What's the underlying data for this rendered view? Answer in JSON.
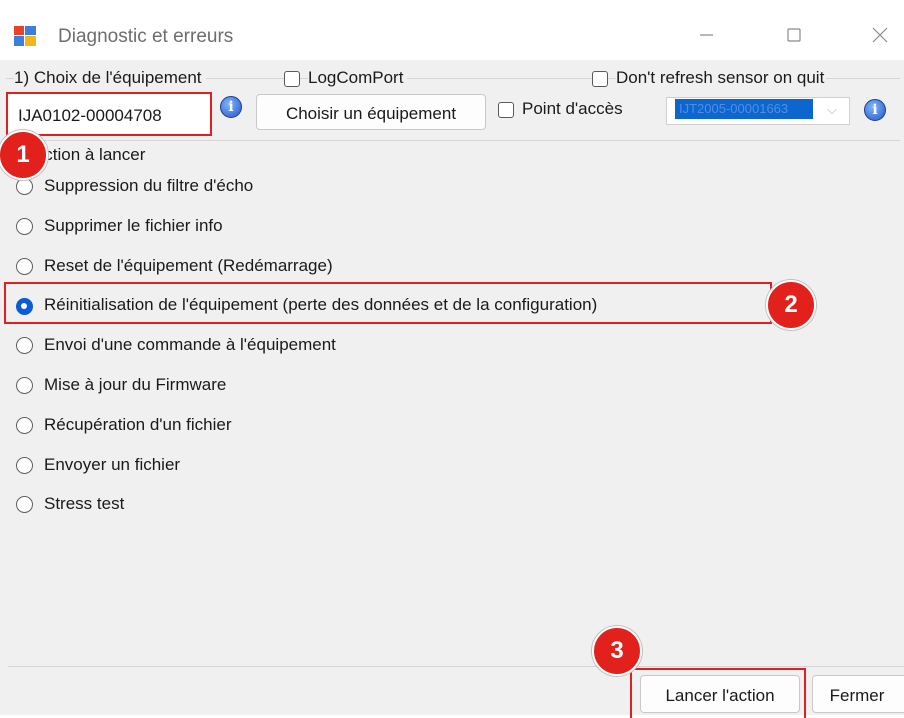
{
  "window": {
    "title": "Diagnostic et erreurs",
    "controls": {
      "minimize": "—",
      "maximize": "☐",
      "close": "✕"
    }
  },
  "equipment_section": {
    "label": "1) Choix de l'équipement",
    "logcomport_label": "LogComPort",
    "logcomport_checked": false,
    "dont_refresh_label": "Don't refresh sensor on quit",
    "dont_refresh_checked": false,
    "equipment_id": "IJA0102-00004708",
    "choose_button": "Choisir un équipement",
    "access_point_label": "Point d'accès",
    "access_point_checked": false,
    "access_point_value": "IJT2005-00001663"
  },
  "action_section": {
    "label": "2) Action à lancer",
    "options": [
      {
        "label": "Suppression du filtre d'écho",
        "selected": false
      },
      {
        "label": "Supprimer le fichier info",
        "selected": false
      },
      {
        "label": "Reset de l'équipement (Redémarrage)",
        "selected": false
      },
      {
        "label": "Réinitialisation de l'équipement (perte des données et de la configuration)",
        "selected": true
      },
      {
        "label": "Envoi d'une commande à l'équipement",
        "selected": false
      },
      {
        "label": "Mise à jour du Firmware",
        "selected": false
      },
      {
        "label": "Récupération d'un fichier",
        "selected": false
      },
      {
        "label": "Envoyer un fichier",
        "selected": false
      },
      {
        "label": "Stress test",
        "selected": false
      }
    ]
  },
  "footer": {
    "launch_button": "Lancer l'action",
    "close_button": "Fermer"
  },
  "annotations": {
    "badges": [
      "1",
      "2",
      "3"
    ],
    "color": "#e3211c"
  },
  "colors": {
    "selection_blue": "#0b5cd6",
    "highlight_red": "#e02020"
  }
}
